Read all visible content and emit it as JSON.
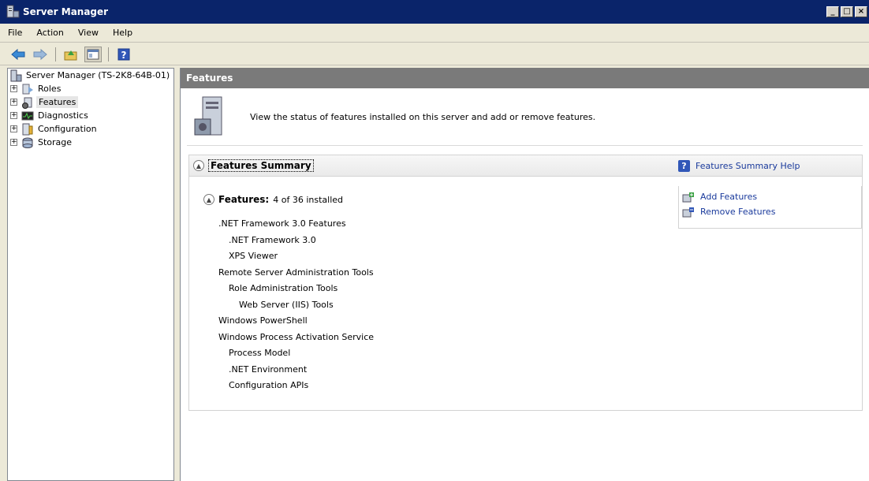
{
  "window": {
    "title": "Server Manager",
    "controls": [
      "_",
      "□",
      "×"
    ]
  },
  "menu": {
    "items": [
      "File",
      "Action",
      "View",
      "Help"
    ]
  },
  "toolbar": {
    "buttons": [
      "back-icon",
      "forward-icon",
      "folder-up-icon",
      "show-hide-icon",
      "help-icon"
    ]
  },
  "tree": {
    "root": "Server Manager (TS-2K8-64B-01)",
    "items": [
      {
        "label": "Roles",
        "icon": "roles-icon"
      },
      {
        "label": "Features",
        "icon": "features-icon",
        "selected": true
      },
      {
        "label": "Diagnostics",
        "icon": "diagnostics-icon"
      },
      {
        "label": "Configuration",
        "icon": "configuration-icon"
      },
      {
        "label": "Storage",
        "icon": "storage-icon"
      }
    ]
  },
  "content": {
    "header": "Features",
    "description": "View the status of features installed on this server and add or remove features.",
    "summary": {
      "title": "Features Summary",
      "help_link": "Features Summary Help",
      "features_label": "Features:",
      "features_count": "4 of 36 installed",
      "actions": {
        "add": "Add Features",
        "remove": "Remove Features"
      },
      "features": [
        {
          "name": ".NET Framework 3.0 Features",
          "level": 0
        },
        {
          "name": ".NET Framework 3.0",
          "level": 1
        },
        {
          "name": "XPS Viewer",
          "level": 1
        },
        {
          "name": "Remote Server Administration Tools",
          "level": 0
        },
        {
          "name": "Role Administration Tools",
          "level": 1
        },
        {
          "name": "Web Server (IIS) Tools",
          "level": 2
        },
        {
          "name": "Windows PowerShell",
          "level": 0
        },
        {
          "name": "Windows Process Activation Service",
          "level": 0
        },
        {
          "name": "Process Model",
          "level": 1
        },
        {
          "name": ".NET Environment",
          "level": 1
        },
        {
          "name": "Configuration APIs",
          "level": 1
        }
      ]
    }
  }
}
